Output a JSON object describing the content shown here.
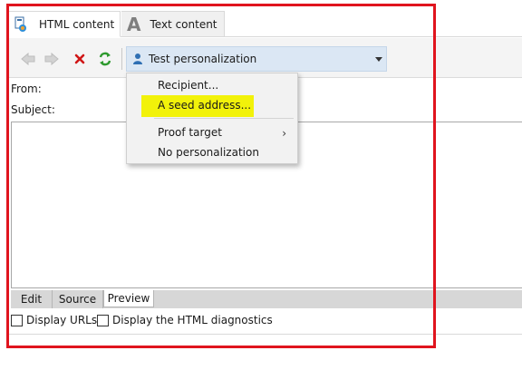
{
  "tabs": {
    "html_label": "HTML content",
    "text_label": "Text content"
  },
  "toolbar": {
    "personalization_label": "Test personalization"
  },
  "form": {
    "from_label": "From:",
    "subject_label": "Subject:"
  },
  "menu": {
    "recipient": "Recipient...",
    "seed_address": "A seed address...",
    "proof_target": "Proof target",
    "no_personalization": "No personalization",
    "submenu_arrow": "›"
  },
  "bottom_tabs": {
    "edit": "Edit",
    "source": "Source",
    "preview": "Preview",
    "active": "Preview"
  },
  "options": {
    "display_urls": "Display URLs",
    "display_urls_checked": false,
    "display_html_diagnostics": "Display the HTML diagnostics",
    "display_html_diagnostics_checked": false
  },
  "colors": {
    "highlight_frame": "#e0141e",
    "seed_highlight": "#f2f20a",
    "combo_background": "#dbe7f4",
    "refresh_icon": "#2e9a2e",
    "delete_icon": "#d01616"
  },
  "icons": {
    "html_tab": "html-document-icon",
    "text_tab": "text-a-icon",
    "back": "back-arrow-icon",
    "forward": "forward-arrow-icon",
    "delete": "delete-x-icon",
    "refresh": "refresh-icon",
    "user": "user-icon",
    "dropdown": "chevron-down-icon"
  }
}
